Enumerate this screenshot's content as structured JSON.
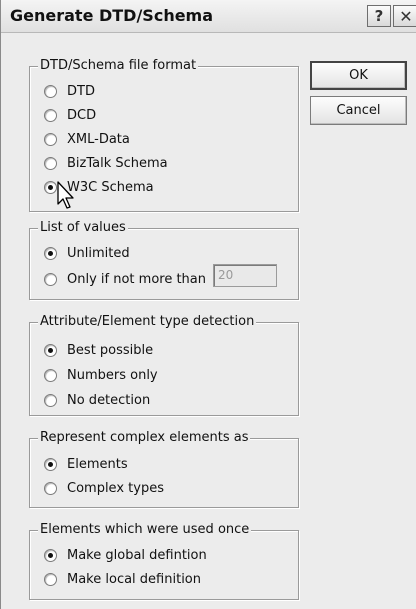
{
  "window": {
    "title": "Generate DTD/Schema",
    "help_glyph": "?",
    "close_glyph": "✕"
  },
  "buttons": {
    "ok": "OK",
    "cancel": "Cancel"
  },
  "file_format": {
    "label": "DTD/Schema file format",
    "options": [
      "DTD",
      "DCD",
      "XML-Data",
      "BizTalk Schema",
      "W3C Schema"
    ],
    "selected": "W3C Schema"
  },
  "list_of_values": {
    "label": "List of values",
    "options": [
      "Unlimited",
      "Only if not more than"
    ],
    "selected": "Unlimited",
    "limit_value": "20"
  },
  "type_detection": {
    "label": "Attribute/Element type detection",
    "options": [
      "Best possible",
      "Numbers only",
      "No detection"
    ],
    "selected": "Best possible"
  },
  "complex_elements": {
    "label": "Represent complex elements as",
    "options": [
      "Elements",
      "Complex types"
    ],
    "selected": "Elements"
  },
  "used_once": {
    "label": "Elements which were used once",
    "options": [
      "Make global defintion",
      "Make local definition"
    ],
    "selected": "Make global defintion"
  },
  "icons": {
    "cursor": "mouse-pointer-icon",
    "help": "question-icon",
    "close": "close-icon"
  }
}
